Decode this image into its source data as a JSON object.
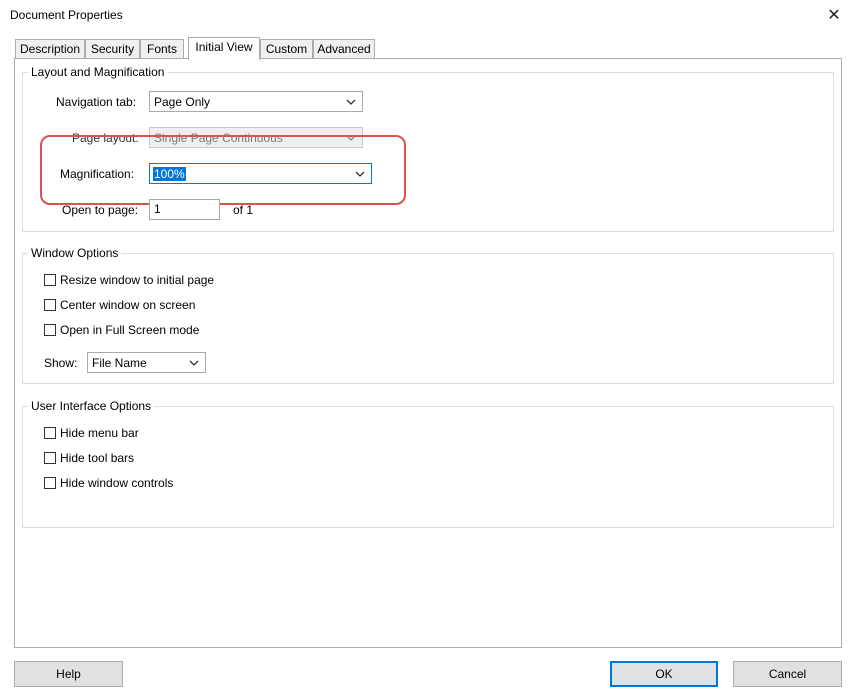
{
  "window": {
    "title": "Document Properties",
    "close_glyph": "✕"
  },
  "tabs": [
    "Description",
    "Security",
    "Fonts",
    "Initial View",
    "Custom",
    "Advanced"
  ],
  "active_tab": "Initial View",
  "layout_group": {
    "legend": "Layout and Magnification",
    "navigation_tab_label": "Navigation tab:",
    "navigation_tab_value": "Page Only",
    "page_layout_label": "Page layout:",
    "page_layout_value": "Single Page Continuous",
    "magnification_label": "Magnification:",
    "magnification_value": "100%",
    "open_to_page_label": "Open to page:",
    "open_to_page_value": "1",
    "of_pages": "of 1"
  },
  "window_group": {
    "legend": "Window Options",
    "checkboxes": [
      "Resize window to initial page",
      "Center window on screen",
      "Open in Full Screen mode"
    ],
    "show_label": "Show:",
    "show_value": "File Name"
  },
  "ui_group": {
    "legend": "User Interface Options",
    "checkboxes": [
      "Hide menu bar",
      "Hide tool bars",
      "Hide window controls"
    ]
  },
  "buttons": {
    "help": "Help",
    "ok": "OK",
    "cancel": "Cancel"
  },
  "colors": {
    "accent": "#0078d7",
    "highlight_ring": "#d9534f"
  }
}
